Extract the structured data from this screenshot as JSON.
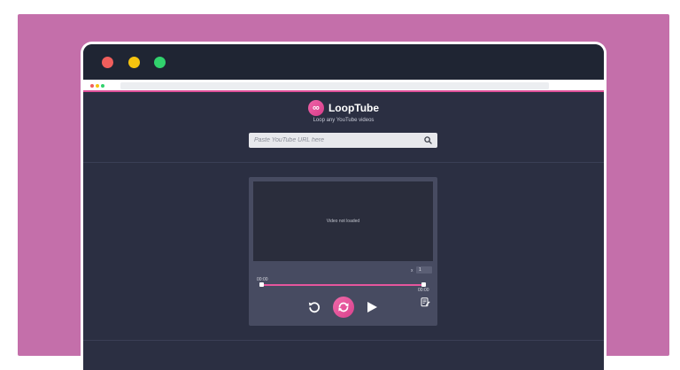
{
  "app": {
    "name": "LoopTube",
    "tagline": "Loop any YouTube videos",
    "logo_glyph": "∞"
  },
  "search": {
    "placeholder": "Paste YouTube URL here",
    "value": ""
  },
  "player": {
    "status_message": "Video not loaded",
    "speed_label": "x",
    "speed_value": "1",
    "time_start": "00:00",
    "time_end": "00:00"
  },
  "icons": {
    "search": "search-icon",
    "rewind": "rewind-icon",
    "loop": "loop-icon",
    "play": "play-icon",
    "notes": "notes-icon"
  },
  "colors": {
    "accent": "#e0529a",
    "background": "#c46faa",
    "window": "#2b2f42",
    "player": "#474b61"
  }
}
